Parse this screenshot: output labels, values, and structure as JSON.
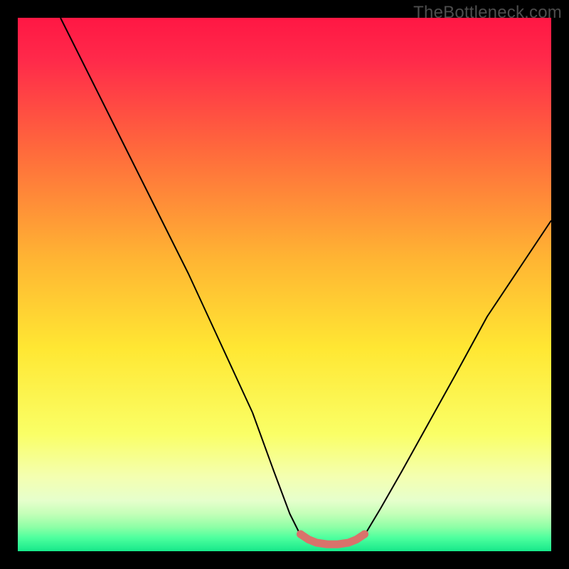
{
  "watermark": "TheBottleneck.com",
  "chart_data": {
    "type": "line",
    "title": "",
    "xlabel": "",
    "ylabel": "",
    "xlim": [
      0,
      100
    ],
    "ylim": [
      0,
      100
    ],
    "legend": false,
    "grid": false,
    "background_gradient_stops": [
      {
        "offset": 0.0,
        "color": "#ff1744"
      },
      {
        "offset": 0.08,
        "color": "#ff2a4a"
      },
      {
        "offset": 0.25,
        "color": "#ff6a3c"
      },
      {
        "offset": 0.45,
        "color": "#ffb433"
      },
      {
        "offset": 0.62,
        "color": "#ffe733"
      },
      {
        "offset": 0.78,
        "color": "#faff66"
      },
      {
        "offset": 0.86,
        "color": "#f4ffb0"
      },
      {
        "offset": 0.905,
        "color": "#e6ffcc"
      },
      {
        "offset": 0.93,
        "color": "#c4ffb8"
      },
      {
        "offset": 0.955,
        "color": "#8dffa6"
      },
      {
        "offset": 0.975,
        "color": "#4dff9e"
      },
      {
        "offset": 1.0,
        "color": "#17e88a"
      }
    ],
    "series": [
      {
        "name": "left-curve",
        "color": "#000000",
        "width": 2,
        "x": [
          8,
          14,
          20,
          26,
          32,
          38,
          44,
          48,
          51,
          53
        ],
        "y": [
          100,
          88,
          76,
          64,
          52,
          39,
          26,
          15,
          7,
          3
        ]
      },
      {
        "name": "right-curve",
        "color": "#000000",
        "width": 2,
        "x": [
          65,
          68,
          72,
          77,
          82,
          88,
          94,
          100
        ],
        "y": [
          3,
          8,
          15,
          24,
          33,
          44,
          53,
          62
        ]
      },
      {
        "name": "bottom-marker-band",
        "color": "#d9726b",
        "width": 11,
        "linecap": "round",
        "x": [
          53,
          54.5,
          56,
          58,
          60,
          62,
          63.5,
          65
        ],
        "y": [
          3.2,
          2.2,
          1.6,
          1.3,
          1.3,
          1.6,
          2.2,
          3.2
        ]
      }
    ]
  }
}
